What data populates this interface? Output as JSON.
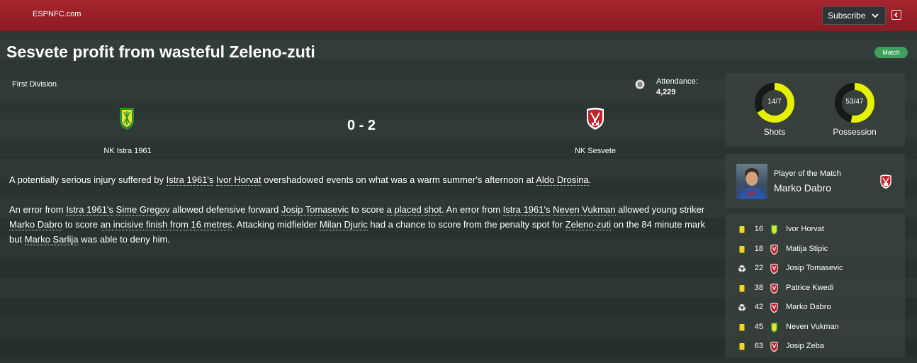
{
  "header": {
    "brand": "ESPNFC.com",
    "subscribe_label": "Subscribe"
  },
  "article": {
    "title": "Sesvete profit from wasteful Zeleno-zuti",
    "badge": "Match"
  },
  "match": {
    "competition": "First Division",
    "attendance_label": "Attendance:",
    "attendance_value": "4,229",
    "home_team": "NK Istra 1961",
    "away_team": "NK Sesvete",
    "score": "0 - 2"
  },
  "report": {
    "p1": [
      {
        "t": "A potentially serious injury suffered by "
      },
      {
        "t": "Istra 1961's",
        "link": true
      },
      {
        "t": " "
      },
      {
        "t": "Ivor Horvat",
        "link": true
      },
      {
        "t": " overshadowed events on what was a warm summer's afternoon at "
      },
      {
        "t": "Aldo Drosina",
        "link": true
      },
      {
        "t": "."
      }
    ],
    "p2": [
      {
        "t": "An error from "
      },
      {
        "t": "Istra 1961's",
        "link": true
      },
      {
        "t": " "
      },
      {
        "t": "Sime Gregov",
        "link": true
      },
      {
        "t": " allowed defensive forward "
      },
      {
        "t": "Josip Tomasevic",
        "link": true
      },
      {
        "t": " to score "
      },
      {
        "t": "a placed shot",
        "link": true
      },
      {
        "t": ". An error from "
      },
      {
        "t": "Istra 1961's",
        "link": true
      },
      {
        "t": " "
      },
      {
        "t": "Neven Vukman",
        "link": true
      },
      {
        "t": " allowed young striker "
      },
      {
        "t": "Marko Dabro",
        "link": true
      },
      {
        "t": " to score "
      },
      {
        "t": "an incisive finish from 16 metres",
        "link": true
      },
      {
        "t": ". Attacking midfielder "
      },
      {
        "t": "Milan Djuric",
        "link": true
      },
      {
        "t": " had a chance to score from the penalty spot for "
      },
      {
        "t": "Zeleno-zuti",
        "link": true
      },
      {
        "t": " on the 84 minute mark but "
      },
      {
        "t": "Marko Sarlija",
        "link": true
      },
      {
        "t": " was able to deny him."
      }
    ]
  },
  "stats": {
    "shots": {
      "label": "14/7",
      "caption": "Shots",
      "home_share": 0.667
    },
    "possession": {
      "label": "53/47",
      "caption": "Possession",
      "home_share": 0.53
    }
  },
  "potm": {
    "label": "Player of the Match",
    "name": "Marko Dabro"
  },
  "events": [
    {
      "type": "yellow-card",
      "minute": "16",
      "team": "home",
      "player": "Ivor Horvat"
    },
    {
      "type": "yellow-card",
      "minute": "18",
      "team": "away",
      "player": "Matija Stipic"
    },
    {
      "type": "goal",
      "minute": "22",
      "team": "away",
      "player": "Josip Tomasevic"
    },
    {
      "type": "yellow-card",
      "minute": "38",
      "team": "away",
      "player": "Patrice Kwedi"
    },
    {
      "type": "goal",
      "minute": "42",
      "team": "away",
      "player": "Marko Dabro"
    },
    {
      "type": "yellow-card",
      "minute": "45",
      "team": "home",
      "player": "Neven Vukman"
    },
    {
      "type": "yellow-card",
      "minute": "63",
      "team": "away",
      "player": "Josip Zeba"
    }
  ],
  "colors": {
    "header_red": "#a6242d",
    "accent_yellow": "#e6f000",
    "badge_green": "#3fa05c",
    "card_yellow": "#f2d81c"
  }
}
